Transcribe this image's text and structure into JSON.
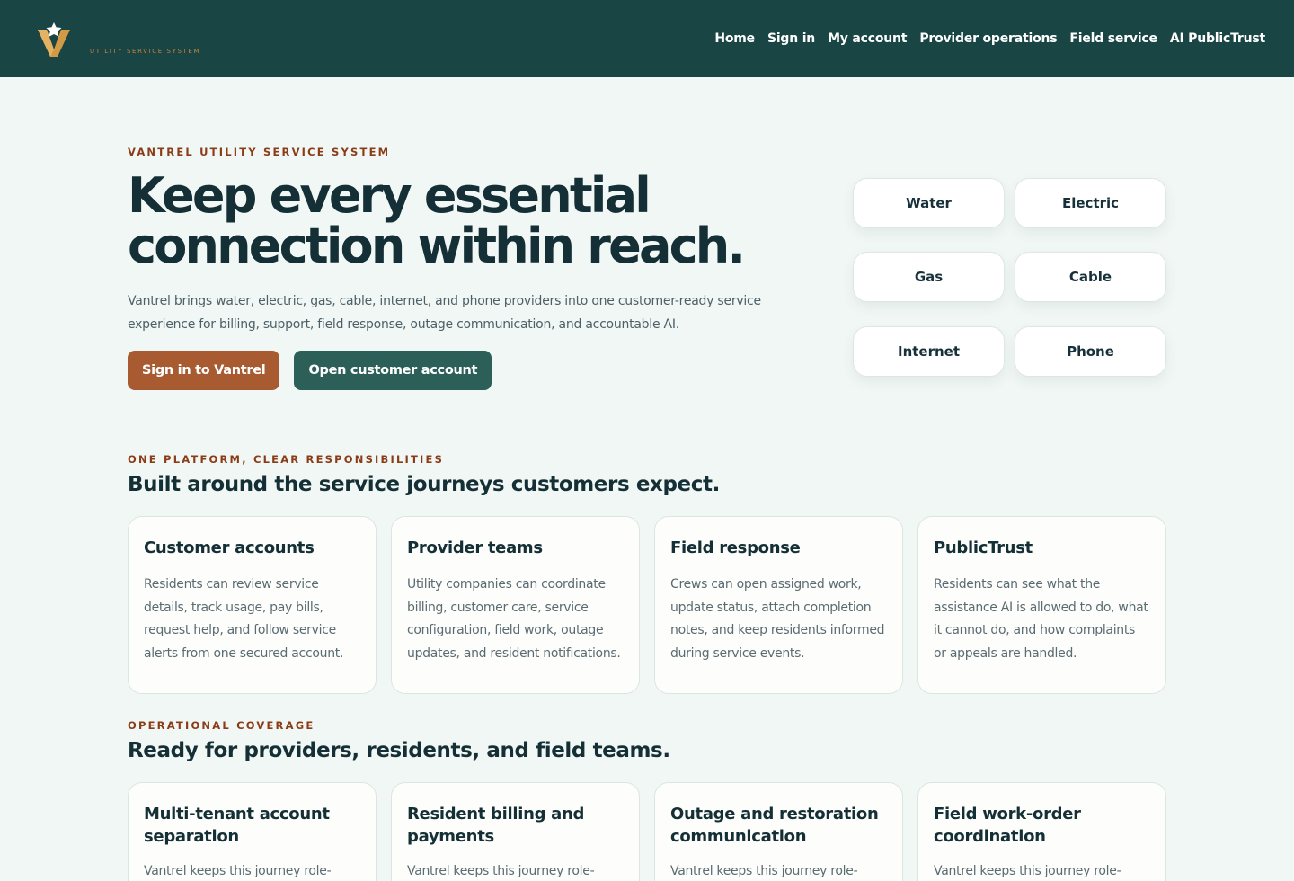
{
  "header": {
    "brand_tag": "UTILITY SERVICE SYSTEM",
    "nav": [
      "Home",
      "Sign in",
      "My account",
      "Provider operations",
      "Field service",
      "AI PublicTrust"
    ]
  },
  "hero": {
    "eyebrow": "VANTREL UTILITY SERVICE SYSTEM",
    "title_line1": "Keep every essential",
    "title_line2": "connection within reach.",
    "lead": "Vantrel brings water, electric, gas, cable, internet, and phone providers into one customer-ready service experience for billing, support, field response, outage communication, and accountable AI.",
    "primary_cta": "Sign in to Vantrel",
    "secondary_cta": "Open customer account",
    "services": [
      "Water",
      "Electric",
      "Gas",
      "Cable",
      "Internet",
      "Phone"
    ]
  },
  "section1": {
    "eyebrow": "ONE PLATFORM, CLEAR RESPONSIBILITIES",
    "title": "Built around the service journeys customers expect.",
    "cards": [
      {
        "title": "Customer accounts",
        "body": "Residents can review service details, track usage, pay bills, request help, and follow service alerts from one secured account."
      },
      {
        "title": "Provider teams",
        "body": "Utility companies can coordinate billing, customer care, service configuration, field work, outage updates, and resident notifications."
      },
      {
        "title": "Field response",
        "body": "Crews can open assigned work, update status, attach completion notes, and keep residents informed during service events."
      },
      {
        "title": "PublicTrust",
        "body": "Residents can see what the assistance AI is allowed to do, what it cannot do, and how complaints or appeals are handled."
      }
    ]
  },
  "section2": {
    "eyebrow": "OPERATIONAL COVERAGE",
    "title": "Ready for providers, residents, and field teams.",
    "cards": [
      {
        "title": "Multi-tenant account separation",
        "body": "Vantrel keeps this journey role-"
      },
      {
        "title": "Resident billing and payments",
        "body": "Vantrel keeps this journey role-"
      },
      {
        "title": "Outage and restoration communication",
        "body": "Vantrel keeps this journey role-"
      },
      {
        "title": "Field work-order coordination",
        "body": "Vantrel keeps this journey role-"
      }
    ]
  },
  "colors": {
    "header_bg": "#194644",
    "accent": "#a85a30",
    "secondary": "#2c5f57",
    "eyebrow": "#8a3c16"
  }
}
